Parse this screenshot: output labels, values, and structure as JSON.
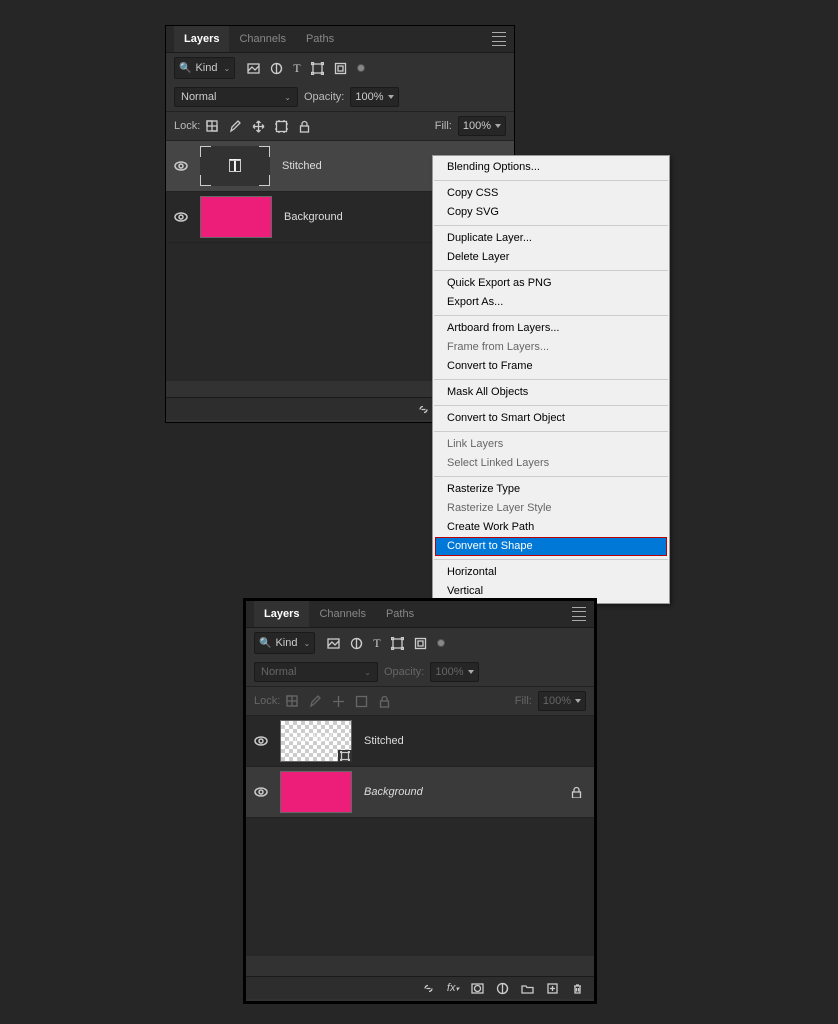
{
  "panel1": {
    "tabs": {
      "layers": "Layers",
      "channels": "Channels",
      "paths": "Paths"
    },
    "kind": "Kind",
    "blend": "Normal",
    "opacityLabel": "Opacity:",
    "opacityValue": "100%",
    "lockLabel": "Lock:",
    "fillLabel": "Fill:",
    "fillValue": "100%",
    "layers": [
      {
        "name": "Stitched"
      },
      {
        "name": "Background"
      }
    ]
  },
  "contextMenu": {
    "blendingOptions": "Blending Options...",
    "copyCSS": "Copy CSS",
    "copySVG": "Copy SVG",
    "duplicateLayer": "Duplicate Layer...",
    "deleteLayer": "Delete Layer",
    "quickExportPNG": "Quick Export as PNG",
    "exportAs": "Export As...",
    "artboardFromLayers": "Artboard from Layers...",
    "frameFromLayers": "Frame from Layers...",
    "convertToFrame": "Convert to Frame",
    "maskAllObjects": "Mask All Objects",
    "convertToSmart": "Convert to Smart Object",
    "linkLayers": "Link Layers",
    "selectLinked": "Select Linked Layers",
    "rasterizeType": "Rasterize Type",
    "rasterizeStyle": "Rasterize Layer Style",
    "createWorkPath": "Create Work Path",
    "convertToShape": "Convert to Shape",
    "horizontal": "Horizontal",
    "vertical": "Vertical"
  },
  "panel2": {
    "tabs": {
      "layers": "Layers",
      "channels": "Channels",
      "paths": "Paths"
    },
    "kind": "Kind",
    "blend": "Normal",
    "opacityLabel": "Opacity:",
    "opacityValue": "100%",
    "lockLabel": "Lock:",
    "fillLabel": "Fill:",
    "fillValue": "100%",
    "layers": [
      {
        "name": "Stitched"
      },
      {
        "name": "Background"
      }
    ]
  }
}
